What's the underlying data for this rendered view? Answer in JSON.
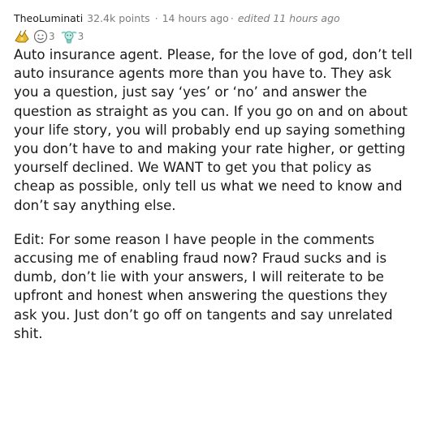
{
  "comment": {
    "author": "TheoLuminati",
    "points": "32.4k points",
    "separator": "·",
    "time": "14 hours ago",
    "edited": "edited 11 hours ago",
    "awards": [
      {
        "icon": "hands-award-icon",
        "count": ""
      },
      {
        "icon": "wholesome-award-icon",
        "count": "3"
      },
      {
        "icon": "helpful-award-icon",
        "count": "3"
      }
    ],
    "paragraphs": [
      "Auto insurance agent. Please, for the love of god, don’t tell auto insurance agents more than you have to. They ask you a question, just say ‘yes’ or ‘no’ and answer the question as straight as you can. If you go on and on about your life story, you will probably end up saying something you don’t have to and making your rate higher, or getting yourself declined. We WANT to get you that policy as cheap as possible, only tell us what we need to know and don’t say anything else.",
      "Edit: For some reason I have people in the comments accusing me of enabling fraud now? Fraud sucks and is dumb, don’t lie with your answers, I will reiterate to be upfront and honest when answering the questions they ask you. Just don’t go off on tangents and say unrelated shit."
    ]
  },
  "colors": {
    "text": "#1a1a1b",
    "meta": "#7c7c7c",
    "award_gold": "#e8b92c",
    "award_teal": "#7fd1c6"
  }
}
